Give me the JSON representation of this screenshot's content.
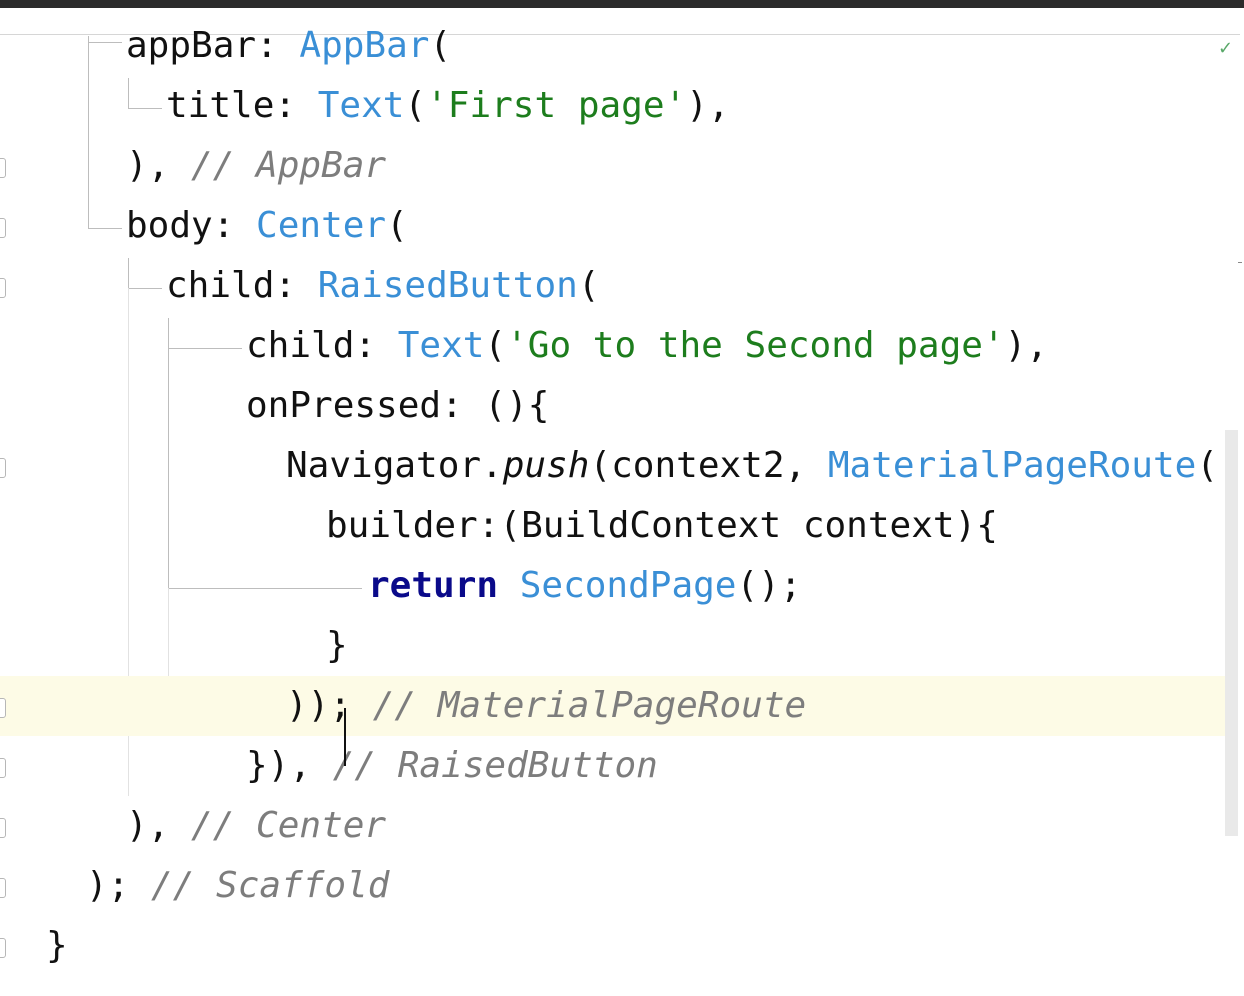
{
  "editor": {
    "status_check": "✓",
    "lines": [
      {
        "indent": 126,
        "tokens": [
          {
            "t": "appBar: ",
            "c": "plain"
          },
          {
            "t": "AppBar",
            "c": "class"
          },
          {
            "t": "(",
            "c": "plain"
          }
        ]
      },
      {
        "indent": 166,
        "tokens": [
          {
            "t": "title: ",
            "c": "plain"
          },
          {
            "t": "Text",
            "c": "class"
          },
          {
            "t": "(",
            "c": "plain"
          },
          {
            "t": "'First page'",
            "c": "str"
          },
          {
            "t": "),",
            "c": "plain"
          }
        ]
      },
      {
        "indent": 126,
        "tokens": [
          {
            "t": "), ",
            "c": "plain"
          },
          {
            "t": "// AppBar",
            "c": "comment"
          }
        ]
      },
      {
        "indent": 126,
        "tokens": [
          {
            "t": "body: ",
            "c": "plain"
          },
          {
            "t": "Center",
            "c": "class"
          },
          {
            "t": "(",
            "c": "plain"
          }
        ]
      },
      {
        "indent": 166,
        "tokens": [
          {
            "t": "child: ",
            "c": "plain"
          },
          {
            "t": "RaisedButton",
            "c": "class"
          },
          {
            "t": "(",
            "c": "plain"
          }
        ]
      },
      {
        "indent": 246,
        "tokens": [
          {
            "t": "child: ",
            "c": "plain"
          },
          {
            "t": "Text",
            "c": "class"
          },
          {
            "t": "(",
            "c": "plain"
          },
          {
            "t": "'Go to the Second page'",
            "c": "str"
          },
          {
            "t": "),",
            "c": "plain"
          }
        ]
      },
      {
        "indent": 246,
        "tokens": [
          {
            "t": "onPressed: (){",
            "c": "plain"
          }
        ]
      },
      {
        "indent": 286,
        "tokens": [
          {
            "t": "Navigator.",
            "c": "plain"
          },
          {
            "t": "push",
            "c": "method"
          },
          {
            "t": "(context2, ",
            "c": "plain"
          },
          {
            "t": "MaterialPageRoute",
            "c": "class"
          },
          {
            "t": "(",
            "c": "plain"
          }
        ]
      },
      {
        "indent": 326,
        "tokens": [
          {
            "t": "builder:(BuildContext context){",
            "c": "plain"
          }
        ]
      },
      {
        "indent": 368,
        "tokens": [
          {
            "t": "return",
            "c": "kw"
          },
          {
            "t": " ",
            "c": "plain"
          },
          {
            "t": "SecondPage",
            "c": "class"
          },
          {
            "t": "();",
            "c": "plain"
          }
        ]
      },
      {
        "indent": 326,
        "tokens": [
          {
            "t": "}",
            "c": "plain"
          }
        ]
      },
      {
        "indent": 286,
        "current": true,
        "tokens": [
          {
            "t": "));",
            "c": "plain"
          },
          {
            "t": " // MaterialPageRoute",
            "c": "comment"
          }
        ]
      },
      {
        "indent": 246,
        "tokens": [
          {
            "t": "}), ",
            "c": "plain"
          },
          {
            "t": "// RaisedButton",
            "c": "comment"
          }
        ]
      },
      {
        "indent": 126,
        "tokens": [
          {
            "t": "), ",
            "c": "plain"
          },
          {
            "t": "// Center",
            "c": "comment"
          }
        ]
      },
      {
        "indent": 86,
        "tokens": [
          {
            "t": "); ",
            "c": "plain"
          },
          {
            "t": "// Scaffold",
            "c": "comment"
          }
        ]
      },
      {
        "indent": 46,
        "tokens": [
          {
            "t": "}",
            "c": "plain"
          }
        ]
      }
    ]
  }
}
